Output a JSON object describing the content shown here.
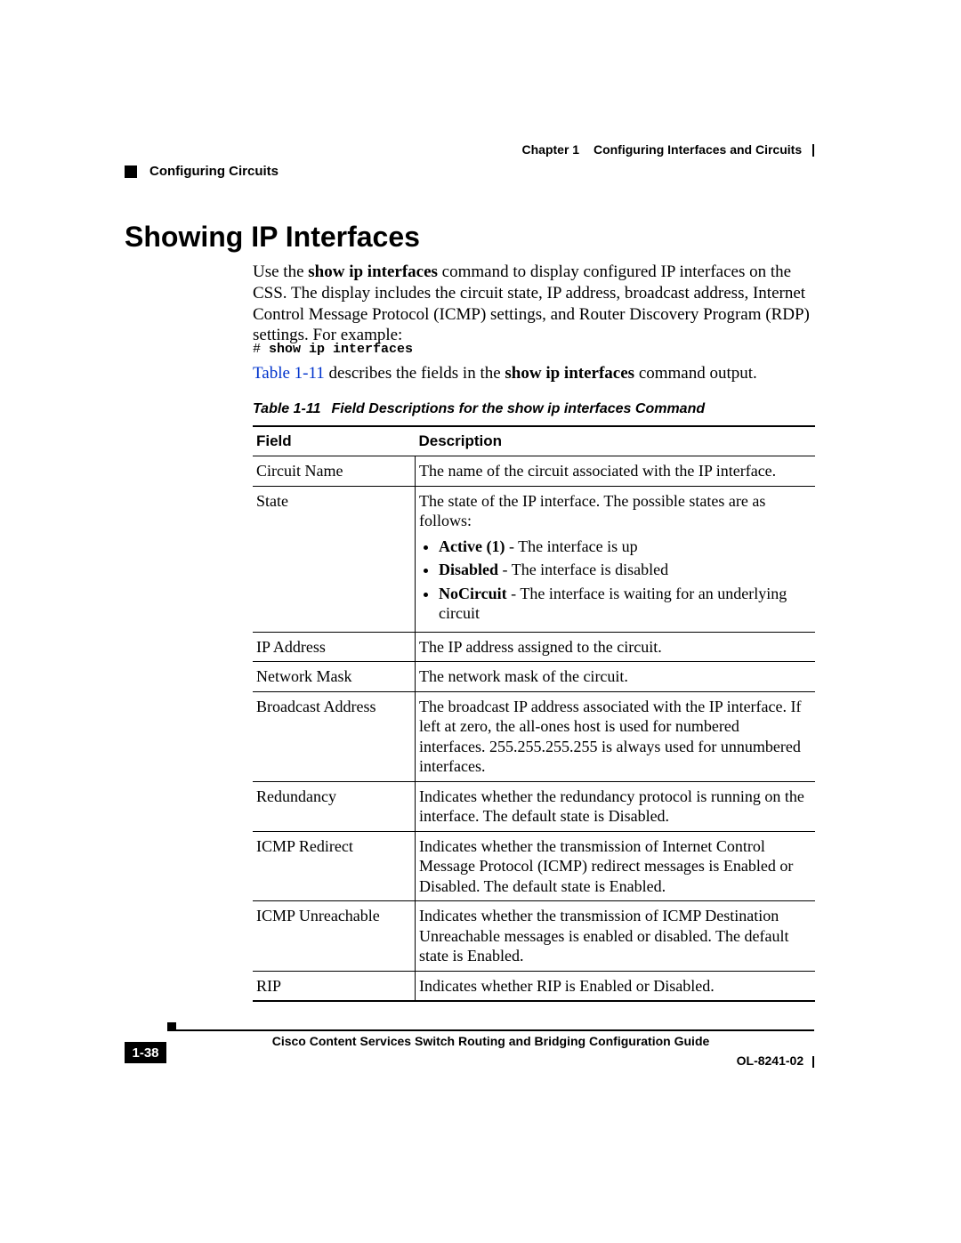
{
  "header": {
    "chapter_label": "Chapter 1",
    "chapter_title": "Configuring Interfaces and Circuits",
    "breadcrumb": "Configuring Circuits"
  },
  "section_heading": "Showing IP Interfaces",
  "intro_before_bold": "Use the ",
  "intro_bold": "show ip interfaces",
  "intro_after_bold": " command to display configured IP interfaces on the CSS. The display includes the circuit state, IP address, broadcast address, Internet Control Message Protocol (ICMP) settings, and Router Discovery Program (RDP) settings. For example:",
  "cmd_prompt": "# ",
  "cmd_text": "show ip interfaces",
  "ref_link": "Table 1-11",
  "ref_mid": " describes the fields in the ",
  "ref_bold": "show ip interfaces",
  "ref_end": " command output.",
  "table_caption_no": "Table 1-11",
  "table_caption_title": "Field Descriptions for the show ip interfaces Command",
  "columns": {
    "c0": "Field",
    "c1": "Description"
  },
  "rows": [
    {
      "field": "Circuit Name",
      "desc": "The name of the circuit associated with the IP interface."
    },
    {
      "field": "State",
      "desc": "The state of the IP interface. The possible states are as follows:",
      "bullets": [
        {
          "b": "Active (1)",
          "t": " - The interface is up"
        },
        {
          "b": "Disabled",
          "t": " - The interface is disabled"
        },
        {
          "b": "NoCircuit",
          "t": " - The interface is waiting for an underlying circuit"
        }
      ]
    },
    {
      "field": "IP Address",
      "desc": "The IP address assigned to the circuit."
    },
    {
      "field": "Network Mask",
      "desc": "The network mask of the circuit."
    },
    {
      "field": "Broadcast Address",
      "desc": "The broadcast IP address associated with the IP interface. If left at zero, the all-ones host is used for numbered interfaces. 255.255.255.255 is always used for unnumbered interfaces."
    },
    {
      "field": "Redundancy",
      "desc": "Indicates whether the redundancy protocol is running on the interface. The default state is Disabled."
    },
    {
      "field": "ICMP Redirect",
      "desc": "Indicates whether the transmission of Internet Control Message Protocol (ICMP) redirect messages is Enabled or Disabled. The default state is Enabled."
    },
    {
      "field": "ICMP Unreachable",
      "desc": "Indicates whether the transmission of ICMP Destination Unreachable messages is enabled or disabled. The default state is Enabled."
    },
    {
      "field": "RIP",
      "desc": "Indicates whether RIP is Enabled or Disabled."
    }
  ],
  "footer": {
    "book": "Cisco Content Services Switch Routing and Bridging Configuration Guide",
    "page": "1-38",
    "docid": "OL-8241-02"
  }
}
